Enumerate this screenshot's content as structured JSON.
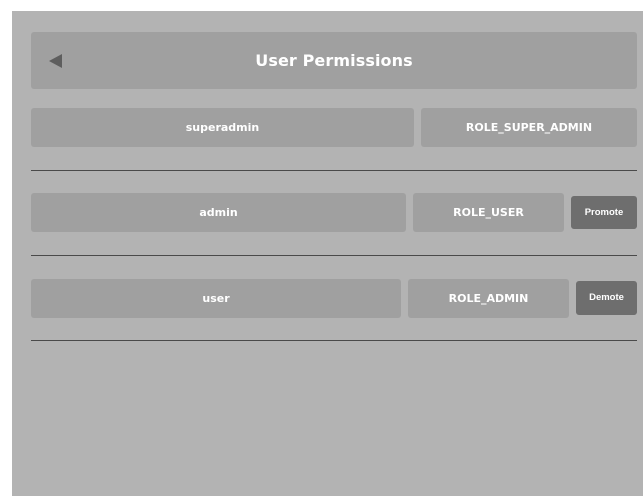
{
  "header": {
    "title": "User Permissions",
    "back_icon": "back-arrow-icon"
  },
  "users": [
    {
      "username": "superadmin",
      "role": "ROLE_SUPER_ADMIN",
      "action": ""
    },
    {
      "username": "admin",
      "role": "ROLE_USER",
      "action": "Promote"
    },
    {
      "username": "user",
      "role": "ROLE_ADMIN",
      "action": "Demote"
    }
  ],
  "colors": {
    "screen_background": "#b3b3b3",
    "cell_background": "#a0a0a0",
    "action_button_background": "#6e6e6e",
    "divider": "#4a4a4a",
    "text": "#ffffff"
  }
}
